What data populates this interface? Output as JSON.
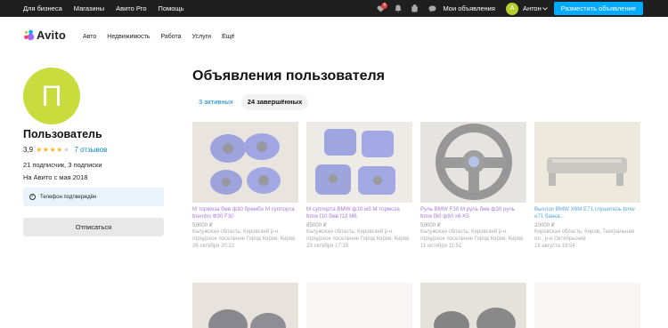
{
  "topbar": {
    "links": [
      "Для бизнеса",
      "Магазины",
      "Авито Pro",
      "Помощь"
    ],
    "notif_count": "6",
    "my_ads": "Мои объявления",
    "avatar_letter": "А",
    "user": "Антон",
    "post_ad": "Разместить объявление"
  },
  "header": {
    "logo": "Avito",
    "nav": [
      "Авто",
      "Недвижимость",
      "Работа",
      "Услуги",
      "Ещё"
    ]
  },
  "profile": {
    "avatar_letter": "П",
    "name": "Пользователь",
    "rating": "3,9",
    "rating_fraction": 0.78,
    "reviews": "7 отзывов",
    "subs": "21 подписчик, 3 подписки",
    "since": "На Авито с мая 2018",
    "verified": "Телефон подтверждён",
    "unsubscribe": "Отписаться"
  },
  "main": {
    "title": "Объявления пользователя",
    "tab_active": "3 активных",
    "tab_done": "24 завершённых"
  },
  "cards": [
    {
      "title": "М тормоза бмв ф30 брембо М суппорта brembo Ф30 F30",
      "price": "59000 ₽",
      "location": "Калужская область, Кировский р-н, городское поселение Город Киров, Киров",
      "date": "26 октября 20:22",
      "title_color": "#8e4dd8"
    },
    {
      "title": "М суппорта BMW ф10 м5 М тормоза bmw f10 бмв f13 М6",
      "price": "85000 ₽",
      "location": "Калужская область, Кировский р-н, городское поселение Город Киров, Киров",
      "date": "23 октября 17:15",
      "title_color": "#8e4dd8"
    },
    {
      "title": "Руль BMW F30 М руль бмв ф30 руль bmw f80 ф80 x6 X5",
      "price": "59000 ₽",
      "location": "Калужская область, Кировский р-н, городское поселение Город Киров, Киров",
      "date": "11 октября 11:51",
      "title_color": "#8e4dd8"
    },
    {
      "title": "Выхлоп BMW X6M E71 глушитель bmw e71 банка...",
      "price": "20000 ₽",
      "location": "Кировская область, Киров, Театральная пл., р-н Октябрьский",
      "date": "18 августа 19:54",
      "title_color": "#1f87d6"
    }
  ]
}
